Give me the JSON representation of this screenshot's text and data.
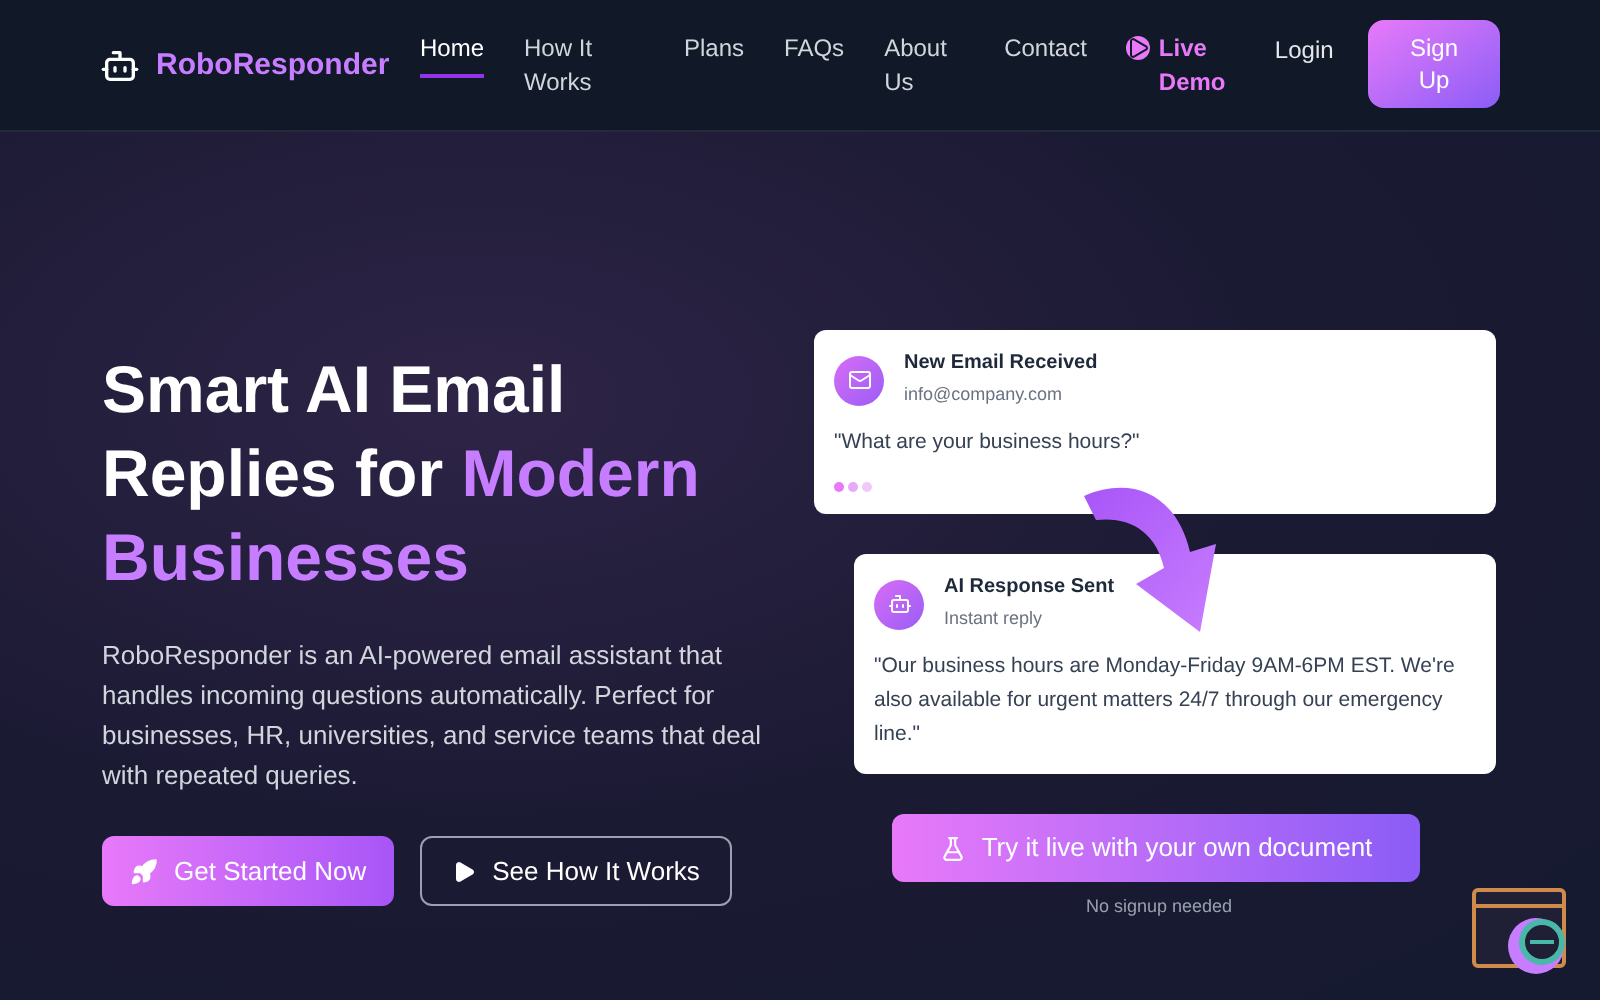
{
  "brand": {
    "name": "RoboResponder"
  },
  "nav": [
    {
      "label": "Home",
      "selected": true,
      "kind": "link"
    },
    {
      "label": "How It Works",
      "selected": false,
      "kind": "link"
    },
    {
      "label": "Plans",
      "selected": false,
      "kind": "link"
    },
    {
      "label": "FAQs",
      "selected": false,
      "kind": "link"
    },
    {
      "label": "About Us",
      "selected": false,
      "kind": "link"
    },
    {
      "label": "Contact",
      "selected": false,
      "kind": "link"
    },
    {
      "label": "Live Demo",
      "selected": false,
      "kind": "demo"
    }
  ],
  "login": "Login",
  "signup": "Sign Up",
  "headline": [
    {
      "text": "Smart AI Email Replies for ",
      "highlight": false
    },
    {
      "text": "Modern Businesses",
      "highlight": true
    }
  ],
  "description": "RoboResponder is an AI-powered email assistant that handles incoming questions automatically. Perfect for businesses, HR, universities, and service teams that deal with repeated queries.",
  "primary_button": "Get Started Now",
  "secondary_button": "See How It Works",
  "email_card": {
    "title": "New Email Received",
    "subtitle": "info@company.com",
    "message": "\"What are your business hours?\""
  },
  "response_card": {
    "title": "AI Response Sent",
    "subtitle": "Instant reply",
    "message": "\"Our business hours are Monday-Friday 9AM-6PM EST. We're also available for urgent matters 24/7 through our emergency line.\""
  },
  "try_button": "Try it live with your own document",
  "try_note": "No signup needed"
}
